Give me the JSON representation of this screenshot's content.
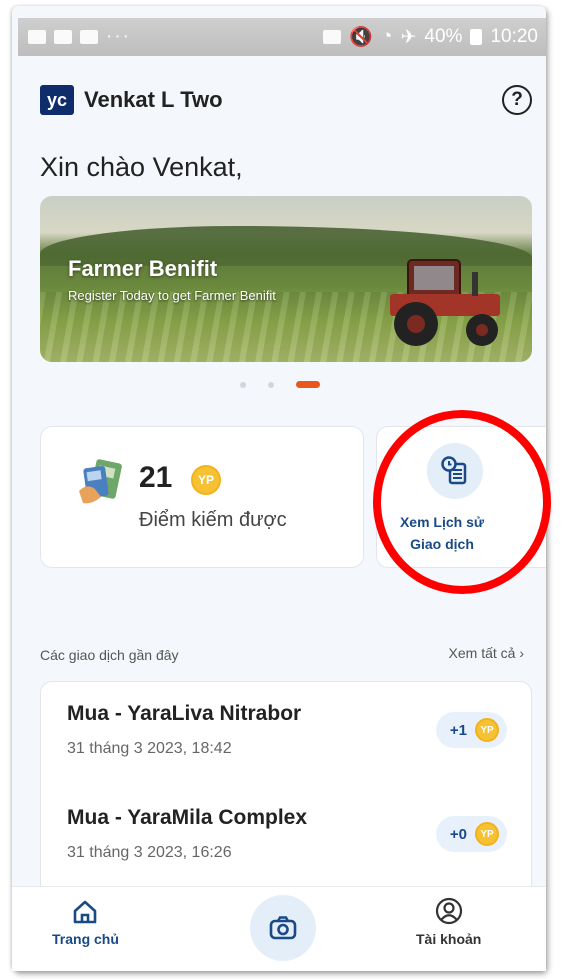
{
  "status_bar": {
    "battery": "40%",
    "time": "10:20",
    "dots": "···"
  },
  "header": {
    "logo_text": "yc",
    "user_name": "Venkat L Two",
    "help_symbol": "?"
  },
  "greeting": "Xin chào Venkat,",
  "banner": {
    "title": "Farmer Benifit",
    "subtitle": "Register Today to get Farmer Benifit",
    "active_slide": 3,
    "slide_count": 3
  },
  "points": {
    "value": "21",
    "badge": "YP",
    "label": "Điểm kiếm được"
  },
  "history": {
    "label_line1": "Xem Lịch sử",
    "label_line2": "Giao dịch"
  },
  "recent": {
    "title": "Các giao dịch gần đây",
    "see_all": "Xem tất cả ›",
    "transactions": [
      {
        "name": "Mua - YaraLiva Nitrabor",
        "date": "31 tháng 3 2023, 18:42",
        "points": "+1",
        "badge": "YP"
      },
      {
        "name": "Mua - YaraMila Complex",
        "date": "31 tháng 3 2023, 16:26",
        "points": "+0",
        "badge": "YP"
      }
    ]
  },
  "bottom_nav": {
    "home": "Trang chủ",
    "account": "Tài khoản"
  },
  "colors": {
    "brand_navy": "#0f2d6b",
    "link_blue": "#1a4a85",
    "accent_orange": "#e8571c",
    "coin_yellow": "#f6c233",
    "highlight_red": "#ff0000"
  }
}
